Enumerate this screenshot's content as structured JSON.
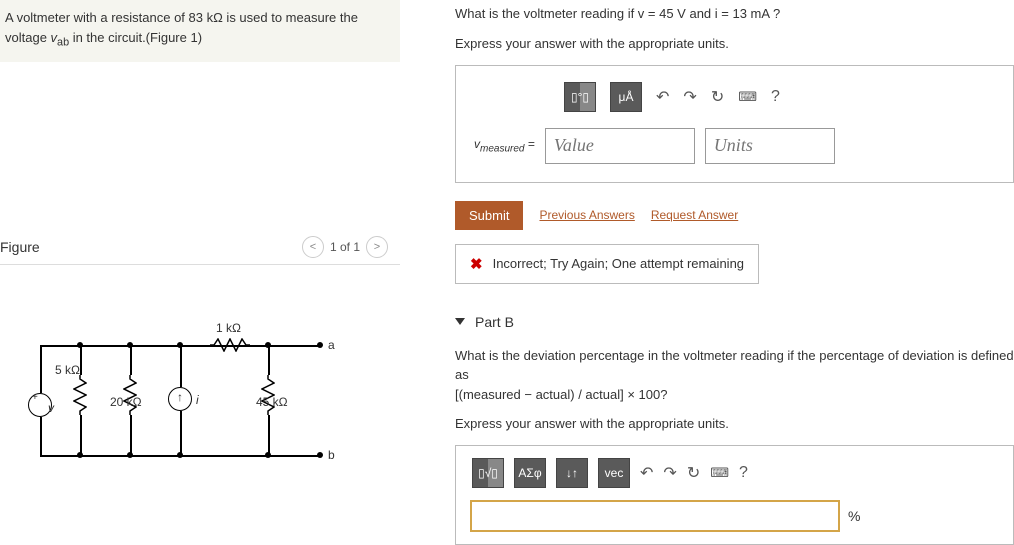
{
  "problem": {
    "text_pre": "A voltmeter with a resistance of 83 kΩ is used to measure the voltage ",
    "var": "v",
    "sub": "ab",
    "text_post": " in the circuit.(Figure 1)"
  },
  "figure": {
    "title": "Figure",
    "nav_count": "1 of 1",
    "labels": {
      "r1": "1 kΩ",
      "r5": "5 kΩ",
      "r20": "20 kΩ",
      "r45": "45 kΩ",
      "v": "v",
      "i": "i",
      "a": "a",
      "b": "b"
    }
  },
  "partA": {
    "question": "What is the voltmeter reading if v = 45 V and i = 13 mA ?",
    "instruction": "Express your answer with the appropriate units.",
    "toolbar": {
      "templates_icon": "▯°▯",
      "mu": "μÅ",
      "undo": "↶",
      "redo": "↷",
      "reset": "↻",
      "keyboard": "⌨",
      "help": "?"
    },
    "var_label": "vmeasured =",
    "value_placeholder": "Value",
    "units_placeholder": "Units",
    "submit": "Submit",
    "prev_link": "Previous Answers",
    "req_link": "Request Answer",
    "feedback": "Incorrect; Try Again; One attempt remaining"
  },
  "partB": {
    "header": "Part B",
    "question_pre": "What is the deviation percentage in the voltmeter reading if the percentage of deviation is defined as",
    "formula": "[(measured − actual) / actual] × 100?",
    "instruction": "Express your answer with the appropriate units.",
    "toolbar": {
      "templates_icon": "▯√▯",
      "greek": "ΑΣφ",
      "updown": "↓↑",
      "vec": "vec",
      "undo": "↶",
      "redo": "↷",
      "reset": "↻",
      "keyboard": "⌨",
      "help": "?"
    },
    "pct": "%"
  }
}
